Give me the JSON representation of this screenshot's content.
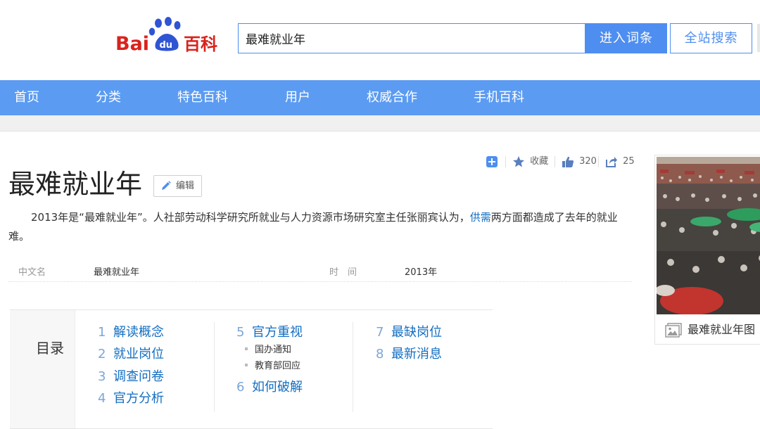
{
  "header": {
    "logo_text": "Baidu百科",
    "search_value": "最难就业年",
    "enter_button": "进入词条",
    "search_all_button": "全站搜索"
  },
  "nav": {
    "items": [
      {
        "label": "首页"
      },
      {
        "label": "分类"
      },
      {
        "label": "特色百科"
      },
      {
        "label": "用户"
      },
      {
        "label": "权威合作"
      },
      {
        "label": "手机百科"
      }
    ]
  },
  "tools": {
    "favorite_label": "收藏",
    "like_count": "320",
    "share_count": "25"
  },
  "entry": {
    "title": "最难就业年",
    "edit_label": "编辑",
    "summary_before": "2013年是“最难就业年”。人社部劳动科学研究所就业与人力资源市场研究室主任张丽宾认为，",
    "summary_link": "供需",
    "summary_after": "两方面都造成了去年的就业难。"
  },
  "basic_info": [
    {
      "key": "中文名",
      "value": "最难就业年"
    },
    {
      "key": "时　间",
      "value": "2013年"
    }
  ],
  "catalog": {
    "label": "目录",
    "col1": [
      {
        "num": "1",
        "text": "解读概念"
      },
      {
        "num": "2",
        "text": "就业岗位"
      },
      {
        "num": "3",
        "text": "调查问卷"
      },
      {
        "num": "4",
        "text": "官方分析"
      }
    ],
    "col2_main": {
      "num": "5",
      "text": "官方重视"
    },
    "col2_subs": [
      "国办通知",
      "教育部回应"
    ],
    "col2_next": {
      "num": "6",
      "text": "如何破解"
    },
    "col3": [
      {
        "num": "7",
        "text": "最缺岗位"
      },
      {
        "num": "8",
        "text": "最新消息"
      }
    ]
  },
  "album": {
    "caption": "最难就业年图"
  },
  "colors": {
    "accent": "#4e8ef0",
    "nav": "#5b9bf2",
    "link": "#136ec2",
    "logo_red": "#d9221c",
    "logo_blue": "#2f55d4"
  }
}
